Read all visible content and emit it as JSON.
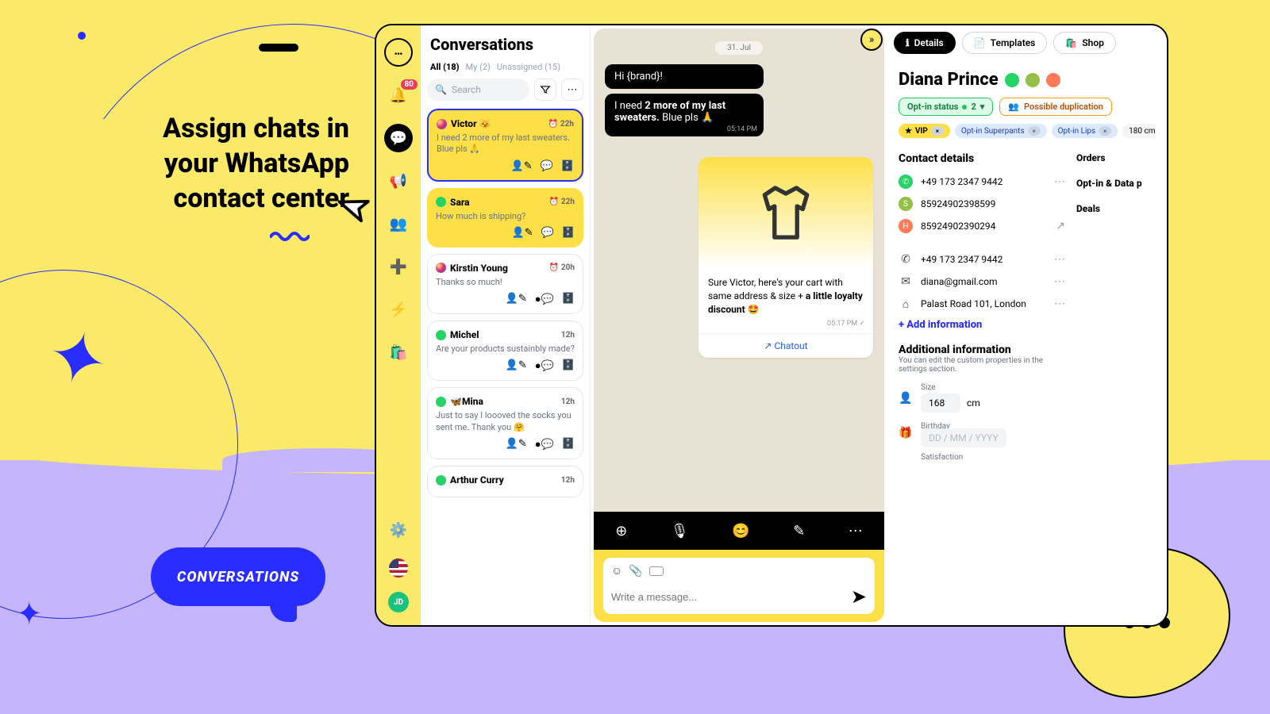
{
  "marketing": {
    "headline": "Assign chats in your WhatsApp contact center",
    "chip": "CONVERSATIONS"
  },
  "rail": {
    "badge": "80",
    "avatar_initials": "JD"
  },
  "conversations": {
    "title": "Conversations",
    "tabs": {
      "all": "All (18)",
      "my": "My (2)",
      "unassigned": "Unassigned (15)"
    },
    "search_placeholder": "Search",
    "items": [
      {
        "name": "Victor 😼",
        "time": "22h",
        "alarm": true,
        "channel": "ig",
        "preview": "I need 2 more of my last sweaters. Blue pls 🙏",
        "style": "hl"
      },
      {
        "name": "Sara",
        "time": "22h",
        "alarm": true,
        "channel": "wa",
        "preview": "How much is shipping?",
        "style": "yl"
      },
      {
        "name": "Kirstin Young",
        "time": "20h",
        "alarm": true,
        "channel": "ig",
        "preview": "Thanks so much!",
        "hasUnread": true
      },
      {
        "name": "Michel",
        "time": "12h",
        "channel": "wa",
        "preview": "Are your products sustainbly made?",
        "hasUnread": true
      },
      {
        "name": "🦋Mina",
        "time": "12h",
        "channel": "wa",
        "preview": "Just to say I loooved the socks you sent me. Thank you 🤗",
        "hasUnread": true
      },
      {
        "name": "Arthur Curry",
        "time": "12h",
        "channel": "wa",
        "preview": ""
      }
    ]
  },
  "chat": {
    "date": "31. Jul",
    "messages": {
      "in1": "Hi {brand}!",
      "in2_a": "I need ",
      "in2_b": "2 more of my last sweaters.",
      "in2_c": " Blue pls 🙏",
      "in2_time": "05:14 PM",
      "out_text_a": "Sure Victor, here's your cart with same address & size + ",
      "out_text_b": "a little loyalty discount",
      "out_text_c": " 🤩",
      "out_time": "05:17 PM",
      "out_link": "Chatout"
    },
    "composer_placeholder": "Write a message..."
  },
  "details": {
    "tabs": {
      "details": "Details",
      "templates": "Templates",
      "shop": "Shop"
    },
    "name": "Diana Prince",
    "optin": {
      "label": "Opt-in status",
      "count": "2"
    },
    "duplication": "Possible duplication",
    "tags": {
      "vip": "VIP",
      "sp": "Opt-in Superpants",
      "lips": "Opt-in Lips",
      "extra": "180 cm"
    },
    "side": {
      "orders": "Orders",
      "optin": "Opt-in & Data p",
      "deals": "Deals"
    },
    "contact": {
      "title": "Contact details",
      "whatsapp": "+49 173 2347 9442",
      "shopify": "85924902398599",
      "hubspot": "85924902390294",
      "phone": "+49 173 2347 9442",
      "email": "diana@gmail.com",
      "address": "Palast Road 101, London",
      "add": "+ Add information"
    },
    "additional": {
      "title": "Additional information",
      "sub": "You can edit the custom properties in the settings section.",
      "size_label": "Size",
      "size_val": "168",
      "size_unit": "cm",
      "birthday_label": "Birthday",
      "birthday_ph": "DD / MM / YYYY",
      "sat_label": "Satisfaction"
    }
  }
}
